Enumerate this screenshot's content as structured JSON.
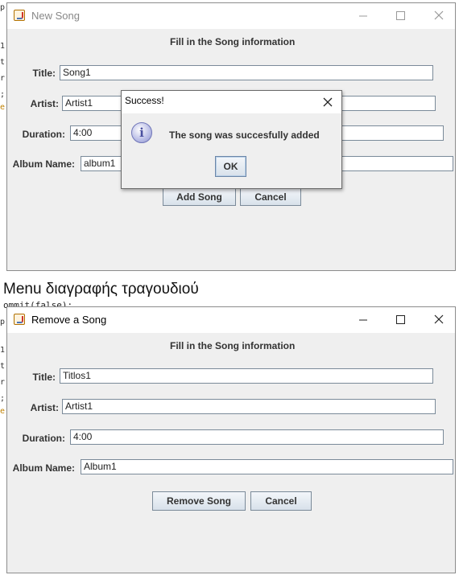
{
  "background_code": {
    "top_fragments": [
      "p",
      "1",
      "t",
      "r",
      ";",
      "e"
    ],
    "bottom_line": "ommit(false);",
    "bottom_fragments": [
      "p",
      "1",
      "t",
      "r",
      ";",
      "e"
    ]
  },
  "section_caption": "Menu διαγραφής τραγουδιού",
  "new_song_window": {
    "title": "New Song",
    "heading": "Fill in the Song information",
    "fields": {
      "title": {
        "label": "Title:",
        "value": "Song1"
      },
      "artist": {
        "label": "Artist:",
        "value": "Artist1"
      },
      "duration": {
        "label": "Duration:",
        "value": "4:00"
      },
      "album": {
        "label": "Album Name:",
        "value": "album1"
      }
    },
    "buttons": {
      "add": "Add Song",
      "cancel": "Cancel"
    }
  },
  "success_dialog": {
    "title": "Success!",
    "message": "The song was succesfully added",
    "ok": "OK",
    "icon_glyph": "i"
  },
  "remove_song_window": {
    "title": "Remove a Song",
    "heading": "Fill in the Song information",
    "fields": {
      "title": {
        "label": "Title:",
        "value": "Titlos1"
      },
      "artist": {
        "label": "Artist:",
        "value": "Artist1"
      },
      "duration": {
        "label": "Duration:",
        "value": "4:00"
      },
      "album": {
        "label": "Album Name:",
        "value": "Album1"
      }
    },
    "buttons": {
      "remove": "Remove Song",
      "cancel": "Cancel"
    }
  },
  "window_controls": {
    "minimize": "minimize-icon",
    "maximize": "maximize-icon",
    "close": "close-icon"
  }
}
